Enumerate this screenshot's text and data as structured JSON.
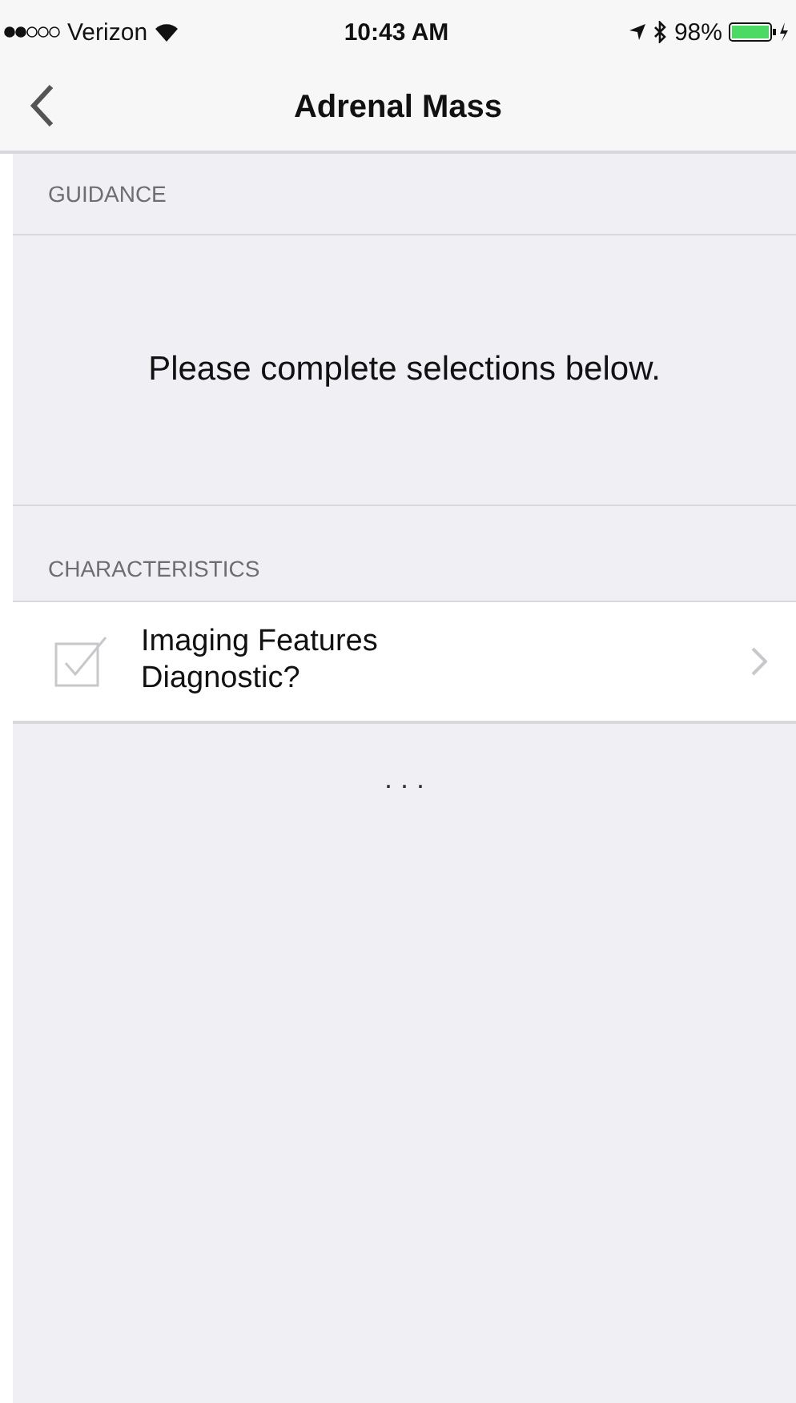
{
  "status_bar": {
    "carrier": "Verizon",
    "time": "10:43 AM",
    "battery": "98%"
  },
  "nav": {
    "title": "Adrenal Mass"
  },
  "guidance": {
    "header": "GUIDANCE",
    "message": "Please complete selections below."
  },
  "characteristics": {
    "header": "CHARACTERISTICS",
    "items": [
      {
        "label": "Imaging Features Diagnostic?",
        "checked": false
      }
    ],
    "more": ". . ."
  }
}
